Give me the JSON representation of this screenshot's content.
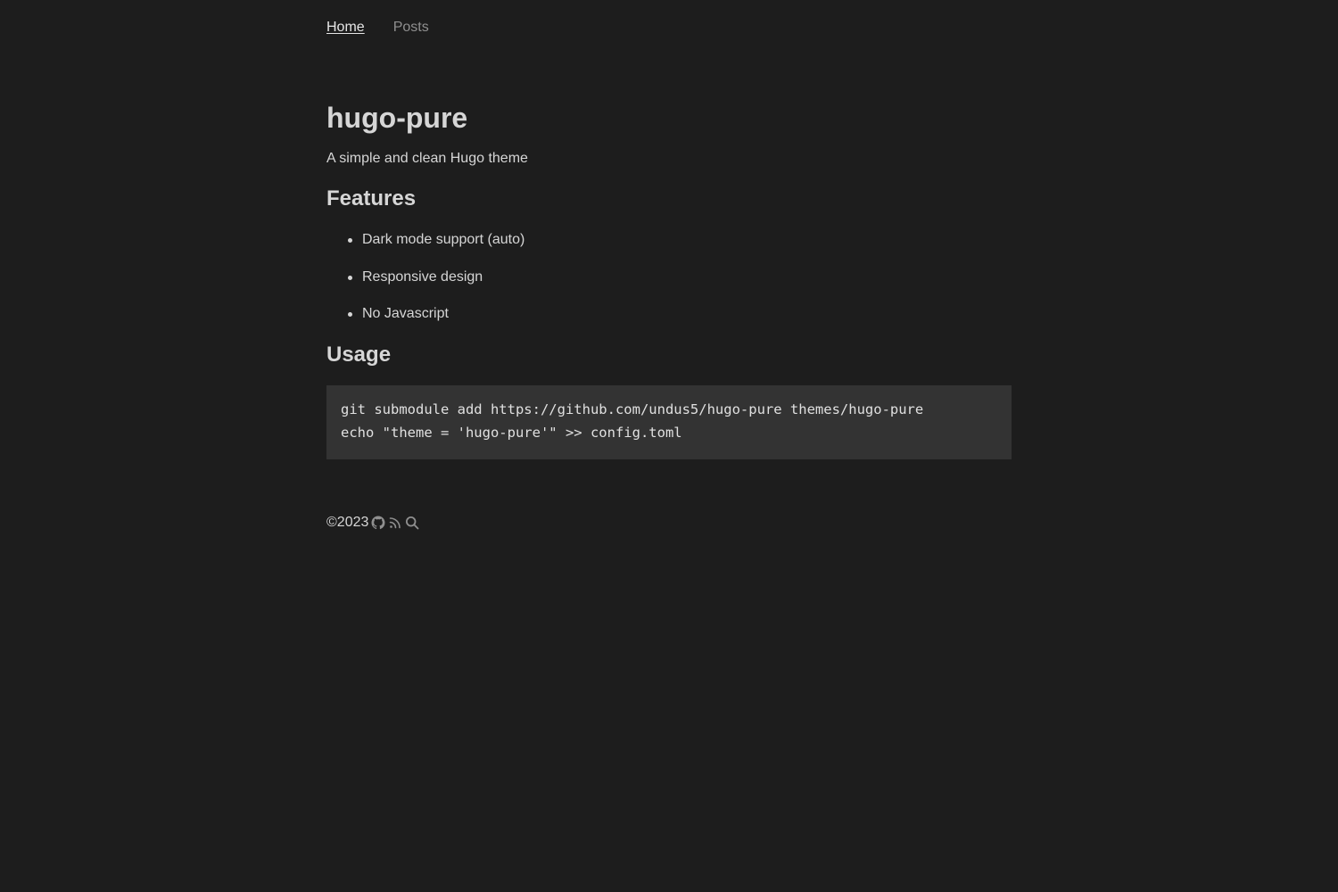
{
  "nav": {
    "home": "Home",
    "posts": "Posts"
  },
  "main": {
    "title": "hugo-pure",
    "tagline": "A simple and clean Hugo theme",
    "features_heading": "Features",
    "features": [
      "Dark mode support (auto)",
      "Responsive design",
      "No Javascript"
    ],
    "usage_heading": "Usage",
    "code_lines": [
      "git submodule add https://github.com/undus5/hugo-pure themes/hugo-pure",
      "echo \"theme = 'hugo-pure'\" >> config.toml"
    ]
  },
  "footer": {
    "copyright": "©2023",
    "icons": [
      "github-icon",
      "rss-icon",
      "search-icon"
    ]
  },
  "colors": {
    "background": "#1d1d1d",
    "text": "#d6d6d6",
    "muted": "#8f8f8f",
    "code_background": "#333333"
  }
}
